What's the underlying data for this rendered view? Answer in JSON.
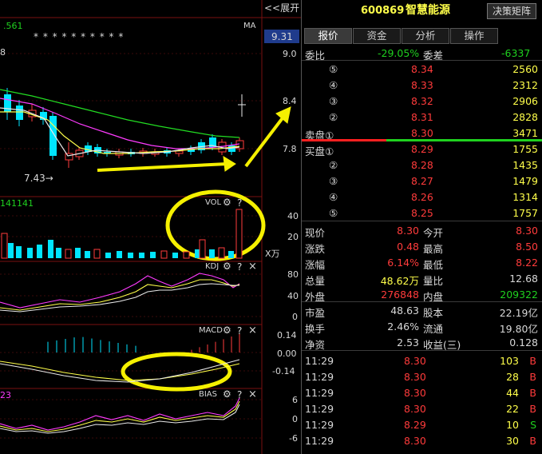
{
  "chart_header": {
    "expand": "<<展开",
    "ma_label": "MA",
    "ma_value": ".561",
    "ma_stars": "* *  *  * * *       * *      *     *",
    "price_top": "9.31",
    "y9": "9.0",
    "y84": "8.4",
    "y78": "7.8",
    "low_mark": "7.43→",
    "left_num": "8"
  },
  "vol": {
    "label": "VOL",
    "series": "141141",
    "y40": "40",
    "y20": "20",
    "unit": "X万"
  },
  "kdj": {
    "label": "KDJ",
    "y80": "80",
    "y40": "40",
    "y0": "0"
  },
  "macd": {
    "label": "MACD",
    "y1": "0.14",
    "y2": "0.00",
    "y3": "-0.14"
  },
  "bias": {
    "label": "BIAS",
    "series": "23",
    "y1": "6",
    "y2": "0",
    "y3": "-6"
  },
  "icons": {
    "gear": "⚙",
    "q": "?",
    "x": "×"
  },
  "header": {
    "code": "600869",
    "name": "智慧能源",
    "button": "决策矩阵"
  },
  "tabs": [
    "报价",
    "资金",
    "分析",
    "操作"
  ],
  "weibi": {
    "l1": "委比",
    "v1": "-29.05%",
    "l2": "委差",
    "v2": "-6337"
  },
  "sells": [
    {
      "n": "⑤",
      "p": "8.34",
      "v": "2560"
    },
    {
      "n": "④",
      "p": "8.33",
      "v": "2312"
    },
    {
      "n": "③",
      "p": "8.32",
      "v": "2906"
    },
    {
      "n": "②",
      "p": "8.31",
      "v": "2828"
    },
    {
      "n": "卖盘①",
      "p": "8.30",
      "v": "3471"
    }
  ],
  "buys": [
    {
      "n": "买盘①",
      "p": "8.29",
      "v": "1755"
    },
    {
      "n": "②",
      "p": "8.28",
      "v": "1435"
    },
    {
      "n": "③",
      "p": "8.27",
      "v": "1479"
    },
    {
      "n": "④",
      "p": "8.26",
      "v": "1314"
    },
    {
      "n": "⑤",
      "p": "8.25",
      "v": "1757"
    }
  ],
  "stats": [
    {
      "a": "现价",
      "av": "8.30",
      "ac": "r",
      "b": "今开",
      "bv": "8.30",
      "bc": "r"
    },
    {
      "a": "涨跌",
      "av": "0.48",
      "ac": "r",
      "b": "最高",
      "bv": "8.50",
      "bc": "r"
    },
    {
      "a": "涨幅",
      "av": "6.14%",
      "ac": "r",
      "b": "最低",
      "bv": "8.22",
      "bc": "r"
    },
    {
      "a": "总量",
      "av": "48.62万",
      "ac": "y",
      "b": "量比",
      "bv": "12.68",
      "bc": "w"
    },
    {
      "a": "外盘",
      "av": "276848",
      "ac": "r",
      "b": "内盘",
      "bv": "209322",
      "bc": "g"
    }
  ],
  "stats2": [
    {
      "a": "市盈",
      "av": "48.63",
      "b": "股本",
      "bv": "22.19亿"
    },
    {
      "a": "换手",
      "av": "2.46%",
      "b": "流通",
      "bv": "19.80亿"
    },
    {
      "a": "净资",
      "av": "2.53",
      "b": "收益(三)",
      "bv": "0.128"
    }
  ],
  "ticks": [
    {
      "t": "11:29",
      "p": "8.30",
      "pc": "r",
      "v": "103",
      "s": "B",
      "sc": "r"
    },
    {
      "t": "11:29",
      "p": "8.30",
      "pc": "r",
      "v": "28",
      "s": "B",
      "sc": "r"
    },
    {
      "t": "11:29",
      "p": "8.30",
      "pc": "r",
      "v": "44",
      "s": "B",
      "sc": "r"
    },
    {
      "t": "11:29",
      "p": "8.30",
      "pc": "r",
      "v": "22",
      "s": "B",
      "sc": "r"
    },
    {
      "t": "11:29",
      "p": "8.29",
      "pc": "r",
      "v": "10",
      "s": "S",
      "sc": "g"
    },
    {
      "t": "11:29",
      "p": "8.30",
      "pc": "r",
      "v": "30",
      "s": "B",
      "sc": "r"
    }
  ],
  "colors": {
    "up": "#ff3b3b",
    "down": "#00e5ff",
    "ma_white": "#e8e8e8",
    "ma_yellow": "#ffff4a",
    "ma_magenta": "#ff3bff",
    "ma_green": "#22dd22",
    "annotation": "#f5f000"
  }
}
